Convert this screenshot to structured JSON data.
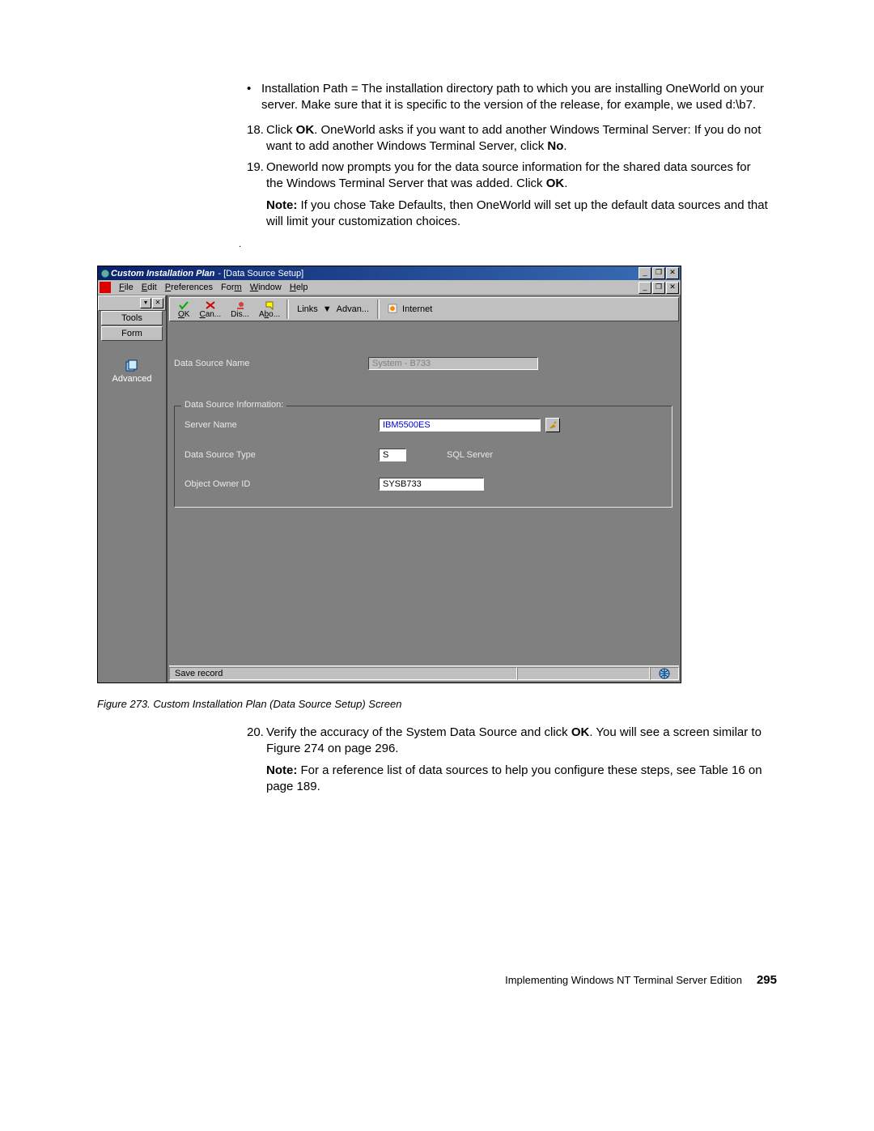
{
  "doc": {
    "bullet_prefix": "Installation Path = The installation directory path to which you are installing OneWorld on your server. Make sure that it is specific to the version of the release, for example, we used d:\\b7.",
    "step18_num": "18.",
    "step18_a": "Click ",
    "step18_b": "OK",
    "step18_c": ". OneWorld asks if you want to add another Windows Terminal Server: If you do not want to add another Windows Terminal Server, click ",
    "step18_d": "No",
    "step18_e": ".",
    "step19_num": "19.",
    "step19_a": "Oneworld now prompts you for the data source information for the shared data sources for the Windows Terminal Server that was added. Click ",
    "step19_b": "OK",
    "step19_c": ".",
    "note1_a": "Note:",
    "note1_b": " If you chose Take Defaults, then OneWorld will set up the default data sources and that will limit your customization choices.",
    "caption": "Figure 273.  Custom Installation Plan (Data Source Setup) Screen",
    "step20_num": "20.",
    "step20_a": "Verify the accuracy of the System Data Source and click ",
    "step20_b": "OK",
    "step20_c": ". You will see a screen similar to Figure 274 on page 296.",
    "note2_a": "Note:",
    "note2_b": " For a reference list of data sources to help you configure these steps, see Table 16 on page 189.",
    "footer_text": "Implementing Windows NT Terminal Server Edition",
    "page_number": "295"
  },
  "win": {
    "title_italic": "Custom Installation Plan",
    "title_rest": "  - [Data Source Setup]",
    "menus": {
      "file": "File",
      "edit": "Edit",
      "prefs": "Preferences",
      "form": "Form",
      "window": "Window",
      "help": "Help"
    },
    "side": {
      "tools": "Tools",
      "form": "Form",
      "advanced": "Advanced"
    },
    "toolbar": {
      "ok": "OK",
      "cancel": "Can...",
      "display": "Dis...",
      "about": "Abo...",
      "links": "Links",
      "advan": "Advan...",
      "internet": "Internet"
    },
    "form": {
      "ds_name_label": "Data Source Name",
      "ds_name_value": "System - B733",
      "group_title": "Data Source Information:",
      "server_label": "Server Name",
      "server_value": "IBM5500ES",
      "type_label": "Data Source Type",
      "type_code": "S",
      "type_desc": "SQL Server",
      "owner_label": "Object Owner ID",
      "owner_value": "SYSB733"
    },
    "status": "Save record"
  }
}
